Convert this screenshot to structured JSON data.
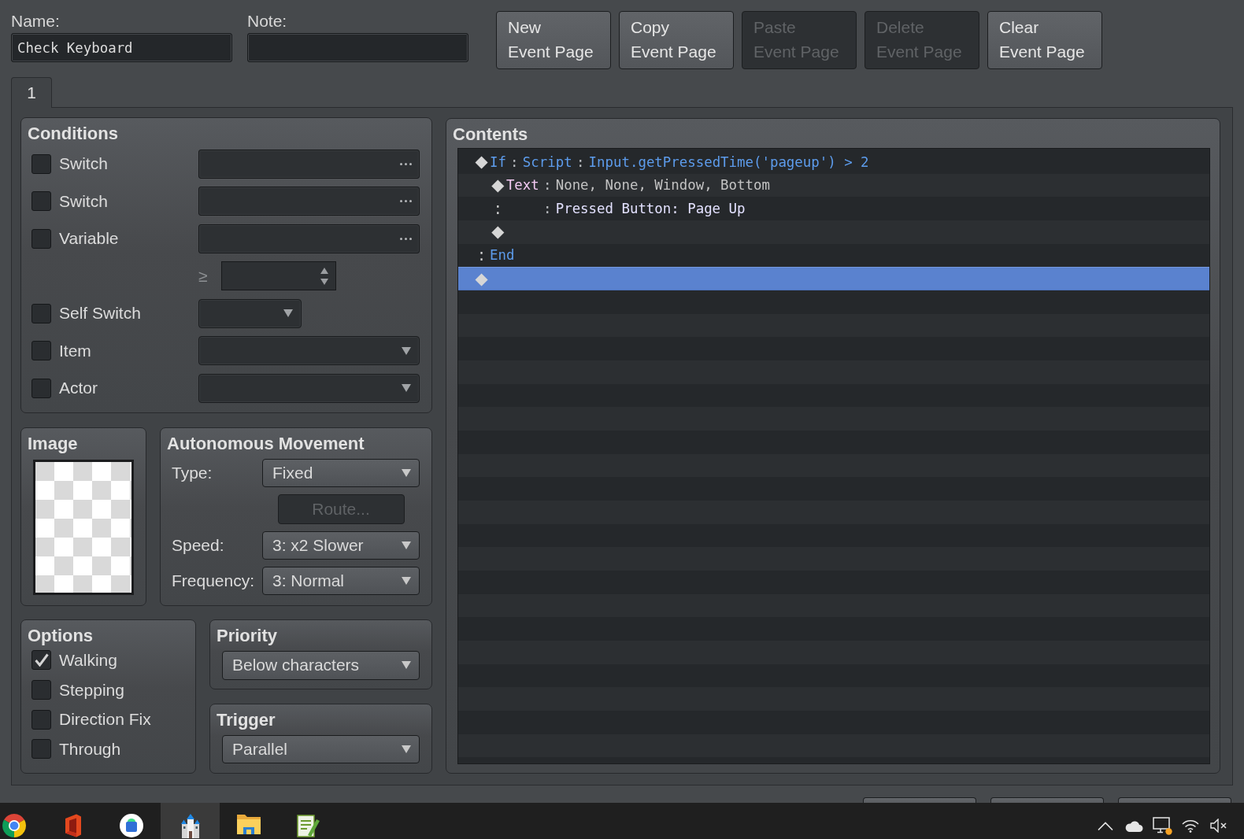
{
  "name_field": {
    "label": "Name:",
    "value": "Check Keyboard"
  },
  "note_field": {
    "label": "Note:"
  },
  "page_buttons": [
    {
      "label": "New\nEvent Page",
      "disabled": false
    },
    {
      "label": "Copy\nEvent Page",
      "disabled": false
    },
    {
      "label": "Paste\nEvent Page",
      "disabled": true
    },
    {
      "label": "Delete\nEvent Page",
      "disabled": true
    },
    {
      "label": "Clear\nEvent Page",
      "disabled": false
    }
  ],
  "tabs": [
    {
      "label": "1",
      "selected": true
    }
  ],
  "conditions": {
    "title": "Conditions",
    "rows": [
      {
        "kind": "picker",
        "label": "Switch",
        "checked": false,
        "disabled": true
      },
      {
        "kind": "picker",
        "label": "Switch",
        "checked": false,
        "disabled": true
      },
      {
        "kind": "variable",
        "label": "Variable",
        "checked": false,
        "disabled": true,
        "operator": "≥"
      },
      {
        "kind": "compact",
        "label": "Self Switch",
        "checked": false,
        "disabled": true
      },
      {
        "kind": "dropdown",
        "label": "Item",
        "checked": false,
        "disabled": true
      },
      {
        "kind": "dropdown",
        "label": "Actor",
        "checked": false,
        "disabled": true
      }
    ]
  },
  "image": {
    "title": "Image"
  },
  "movement": {
    "title": "Autonomous Movement",
    "rows": [
      {
        "kind": "dropdown",
        "label": "Type:",
        "value": "Fixed",
        "disabled": false
      },
      {
        "kind": "button",
        "text": "Route...",
        "disabled": true
      },
      {
        "kind": "dropdown",
        "label": "Speed:",
        "value": "3: x2 Slower",
        "disabled": false
      },
      {
        "kind": "dropdown",
        "label": "Frequency:",
        "value": "3: Normal",
        "disabled": false
      }
    ]
  },
  "options": {
    "title": "Options",
    "items": [
      {
        "label": "Walking",
        "checked": true
      },
      {
        "label": "Stepping",
        "checked": false
      },
      {
        "label": "Direction Fix",
        "checked": false
      },
      {
        "label": "Through",
        "checked": false
      }
    ]
  },
  "priority": {
    "title": "Priority",
    "value": "Below characters"
  },
  "trigger": {
    "title": "Trigger",
    "value": "Parallel"
  },
  "contents": {
    "title": "Contents",
    "rows": [
      {
        "kind": "command",
        "selected": false,
        "segments": [
          {
            "kind": "marker",
            "text": "◆"
          },
          {
            "kind": "keyword",
            "text": "If"
          },
          {
            "kind": "sep",
            "text": ":"
          },
          {
            "kind": "keyword",
            "text": "Script"
          },
          {
            "kind": "sep",
            "text": ":"
          },
          {
            "kind": "condition",
            "text": "Input.getPressedTime('pageup') > 2"
          }
        ],
        "children": [
          {
            "kind": "command",
            "selected": false,
            "segments": [
              {
                "kind": "marker",
                "text": "◆"
              },
              {
                "kind": "command",
                "text": "Text"
              },
              {
                "kind": "sep",
                "text": ":"
              },
              {
                "kind": "param",
                "text": "None, None, Window, Bottom"
              }
            ]
          },
          {
            "kind": "continuation",
            "selected": false,
            "segments": [
              {
                "kind": "marker",
                "text": ":"
              },
              {
                "kind": "sep",
                "text": ":"
              },
              {
                "kind": "message",
                "text": "Pressed Button: Page Up"
              }
            ]
          },
          {
            "kind": "command",
            "selected": false,
            "segments": [
              {
                "kind": "marker",
                "text": "◆"
              }
            ]
          }
        ]
      },
      {
        "kind": "command",
        "selected": false,
        "segments": [
          {
            "kind": "marker",
            "text": ":"
          },
          {
            "kind": "keyword",
            "text": "End"
          }
        ]
      },
      {
        "kind": "command",
        "selected": true,
        "segments": [
          {
            "kind": "marker",
            "text": "◆"
          }
        ]
      }
    ]
  },
  "dialog_buttons": [
    {
      "disabled": false
    },
    {
      "disabled": false
    },
    {
      "disabled": false
    }
  ],
  "taskbar": {
    "apps": [
      {
        "kind": "ring",
        "selected": false
      },
      {
        "kind": "door",
        "selected": false
      },
      {
        "kind": "disc",
        "selected": false
      },
      {
        "kind": "castle",
        "selected": true
      },
      {
        "kind": "folder",
        "selected": false
      },
      {
        "kind": "notepad",
        "selected": false
      }
    ],
    "tray": [
      {
        "kind": "chevron"
      },
      {
        "kind": "cloud"
      },
      {
        "kind": "monitor"
      },
      {
        "kind": "wifi"
      },
      {
        "kind": "speaker"
      }
    ]
  }
}
